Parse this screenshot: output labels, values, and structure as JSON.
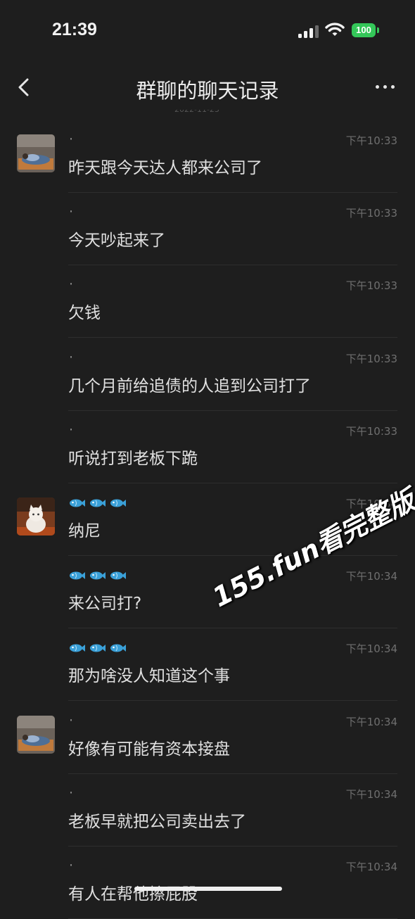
{
  "status": {
    "time": "21:39",
    "battery": "100"
  },
  "nav": {
    "title": "群聊的聊天记录",
    "date": "2022-11-23"
  },
  "colors": {
    "background": "#1e1e1e",
    "battery": "#34c759",
    "fish": "#3aa0d8"
  },
  "messages": [
    {
      "sender": "·",
      "time": "下午10:33",
      "text": "昨天跟今天达人都来公司了",
      "avatar": "avatar-blanket"
    },
    {
      "sender": "·",
      "time": "下午10:33",
      "text": "今天吵起来了"
    },
    {
      "sender": "·",
      "time": "下午10:33",
      "text": "欠钱"
    },
    {
      "sender": "·",
      "time": "下午10:33",
      "text": "几个月前给追债的人追到公司打了"
    },
    {
      "sender": "·",
      "time": "下午10:33",
      "text": "听说打到老板下跪"
    },
    {
      "sender": "fish-fish-fish",
      "time": "下午10:34",
      "text": "纳尼",
      "avatar": "avatar-cat"
    },
    {
      "sender": "fish-fish-fish",
      "time": "下午10:34",
      "text": "来公司打?"
    },
    {
      "sender": "fish-fish-fish",
      "time": "下午10:34",
      "text": "那为啥没人知道这个事"
    },
    {
      "sender": "·",
      "time": "下午10:34",
      "text": "好像有可能有资本接盘",
      "avatar": "avatar-blanket"
    },
    {
      "sender": "·",
      "time": "下午10:34",
      "text": "老板早就把公司卖出去了"
    },
    {
      "sender": "·",
      "time": "下午10:34",
      "text": "有人在帮他擦屁股"
    }
  ],
  "watermark": "155.fun看完整版"
}
